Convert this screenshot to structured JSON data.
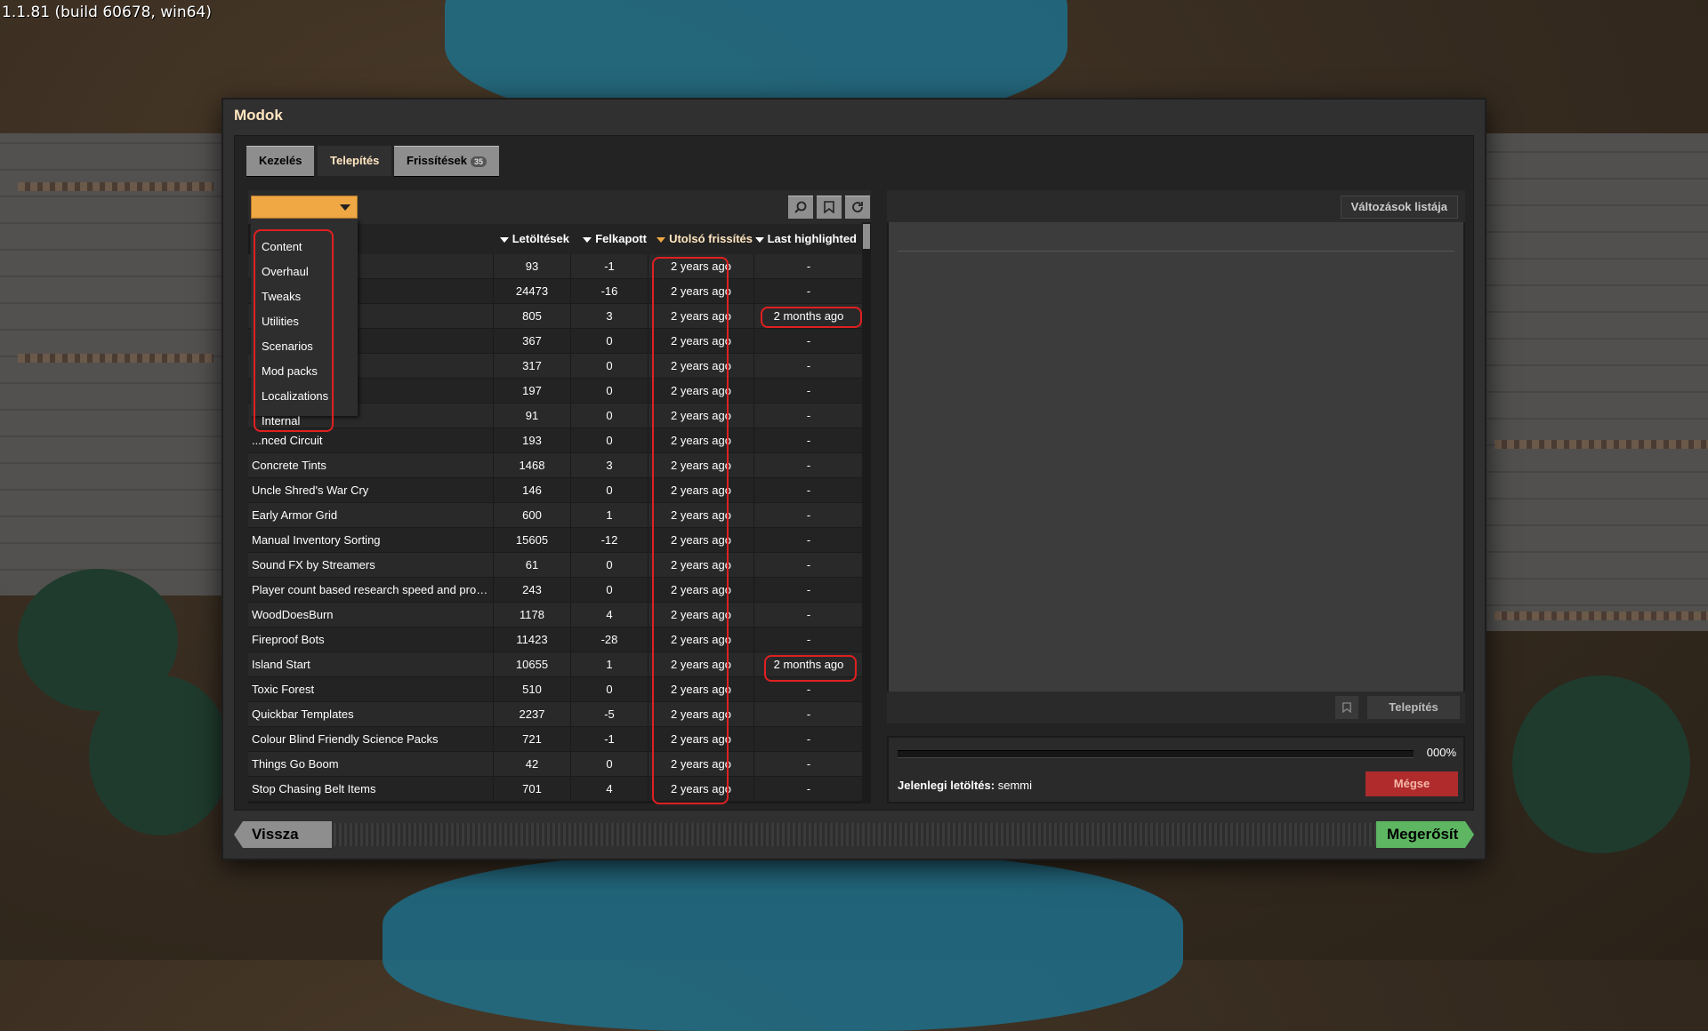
{
  "version_text": "1.1.81 (build 60678, win64)",
  "window": {
    "title": "Modok",
    "tabs": [
      {
        "label": "Kezelés",
        "active": false
      },
      {
        "label": "Telepítés",
        "active": true
      },
      {
        "label": "Frissítések",
        "active": false,
        "badge": "35"
      }
    ]
  },
  "toolbar": {
    "dropdown_value": "",
    "search_icon": "search-icon",
    "bookmark_icon": "bookmark-icon",
    "refresh_icon": "refresh-icon"
  },
  "category_menu": [
    "Content",
    "Overhaul",
    "Tweaks",
    "Utilities",
    "Scenarios",
    "Mod packs",
    "Localizations",
    "Internal"
  ],
  "table": {
    "headers": {
      "downloads": "Letöltések",
      "trending": "Felkapott",
      "updated": "Utolsó frissítés",
      "highlighted": "Last highlighted"
    },
    "rows": [
      {
        "name": "",
        "downloads": "93",
        "trending": "-1",
        "updated": "2 years ago",
        "highlighted": "-"
      },
      {
        "name": "",
        "downloads": "24473",
        "trending": "-16",
        "updated": "2 years ago",
        "highlighted": "-"
      },
      {
        "name": "",
        "downloads": "805",
        "trending": "3",
        "updated": "2 years ago",
        "highlighted": "2 months ago"
      },
      {
        "name": "",
        "downloads": "367",
        "trending": "0",
        "updated": "2 years ago",
        "highlighted": "-"
      },
      {
        "name": "",
        "downloads": "317",
        "trending": "0",
        "updated": "2 years ago",
        "highlighted": "-"
      },
      {
        "name": "",
        "downloads": "197",
        "trending": "0",
        "updated": "2 years ago",
        "highlighted": "-"
      },
      {
        "name": "",
        "downloads": "91",
        "trending": "0",
        "updated": "2 years ago",
        "highlighted": "-"
      },
      {
        "name": "...nced Circuit",
        "downloads": "193",
        "trending": "0",
        "updated": "2 years ago",
        "highlighted": "-"
      },
      {
        "name": "Concrete Tints",
        "downloads": "1468",
        "trending": "3",
        "updated": "2 years ago",
        "highlighted": "-"
      },
      {
        "name": "Uncle Shred's War Cry",
        "downloads": "146",
        "trending": "0",
        "updated": "2 years ago",
        "highlighted": "-"
      },
      {
        "name": "Early Armor Grid",
        "downloads": "600",
        "trending": "1",
        "updated": "2 years ago",
        "highlighted": "-"
      },
      {
        "name": "Manual Inventory Sorting",
        "downloads": "15605",
        "trending": "-12",
        "updated": "2 years ago",
        "highlighted": "-"
      },
      {
        "name": "Sound FX by Streamers",
        "downloads": "61",
        "trending": "0",
        "updated": "2 years ago",
        "highlighted": "-"
      },
      {
        "name": "Player count based research speed and prod...",
        "downloads": "243",
        "trending": "0",
        "updated": "2 years ago",
        "highlighted": "-"
      },
      {
        "name": "WoodDoesBurn",
        "downloads": "1178",
        "trending": "4",
        "updated": "2 years ago",
        "highlighted": "-"
      },
      {
        "name": "Fireproof Bots",
        "downloads": "11423",
        "trending": "-28",
        "updated": "2 years ago",
        "highlighted": "-"
      },
      {
        "name": "Island Start",
        "downloads": "10655",
        "trending": "1",
        "updated": "2 years ago",
        "highlighted": "2 months ago"
      },
      {
        "name": "Toxic Forest",
        "downloads": "510",
        "trending": "0",
        "updated": "2 years ago",
        "highlighted": "-"
      },
      {
        "name": "Quickbar Templates",
        "downloads": "2237",
        "trending": "-5",
        "updated": "2 years ago",
        "highlighted": "-"
      },
      {
        "name": "Colour Blind Friendly Science Packs",
        "downloads": "721",
        "trending": "-1",
        "updated": "2 years ago",
        "highlighted": "-"
      },
      {
        "name": "Things Go Boom",
        "downloads": "42",
        "trending": "0",
        "updated": "2 years ago",
        "highlighted": "-"
      },
      {
        "name": "Stop Chasing Belt Items",
        "downloads": "701",
        "trending": "4",
        "updated": "2 years ago",
        "highlighted": "-"
      }
    ]
  },
  "details": {
    "changelog_label": "Változások listája",
    "install_label": "Telepítés"
  },
  "download": {
    "percent": "000%",
    "progress_fraction": 0,
    "label": "Jelenlegi letöltés:",
    "value": "semmi",
    "cancel_label": "Mégse"
  },
  "footer": {
    "back_label": "Vissza",
    "confirm_label": "Megerősít"
  },
  "colors": {
    "accent_orange": "#f0a844",
    "confirm_green": "#5eb663",
    "cancel_red": "#b02c2c",
    "highlight_outline": "#e02020"
  }
}
